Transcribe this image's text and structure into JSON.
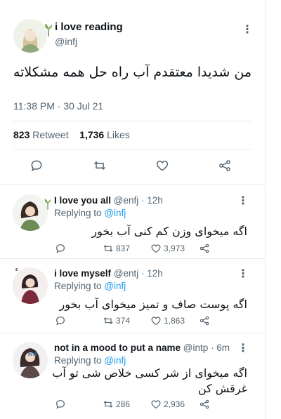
{
  "tweet": {
    "name": "i love reading",
    "handle": "@infj",
    "text": "من شدیدا معتقدم آب راه حل همه مشکلاته",
    "timestamp": "11:38 PM · 30 Jul 21",
    "retweets_count": "823",
    "retweets_label": "Retweet",
    "likes_count": "1,736",
    "likes_label": "Likes",
    "actions": [
      "comment-icon",
      "retweet-icon",
      "like-icon",
      "share-icon"
    ]
  },
  "replies": [
    {
      "name": "I love you all",
      "meta": "@enfj · 12h",
      "replying_prefix": "Replying to",
      "replying_to": "@infj",
      "text": "اگه میخوای وزن کم کنی آب بخور",
      "retweets": "837",
      "likes": "3,973"
    },
    {
      "name": "i love myself",
      "meta": "@entj · 12h",
      "replying_prefix": "Replying to",
      "replying_to": "@infj",
      "text": "اگه پوست صاف و تمیز میخوای آب بخور",
      "retweets": "374",
      "likes": "1,863"
    },
    {
      "name": "not in a mood to put a name",
      "meta": "@intp · 6m",
      "replying_prefix": "Replying to",
      "replying_to": "@infj",
      "text_line1": "اگه میخوای از شر کسی خلاص شی تو آب",
      "text_line2": "غرقش کن",
      "retweets": "286",
      "likes": "2,936"
    }
  ],
  "colors": {
    "accent": "#1d9bf0",
    "muted": "#536471",
    "divider": "#e6ecf0"
  }
}
